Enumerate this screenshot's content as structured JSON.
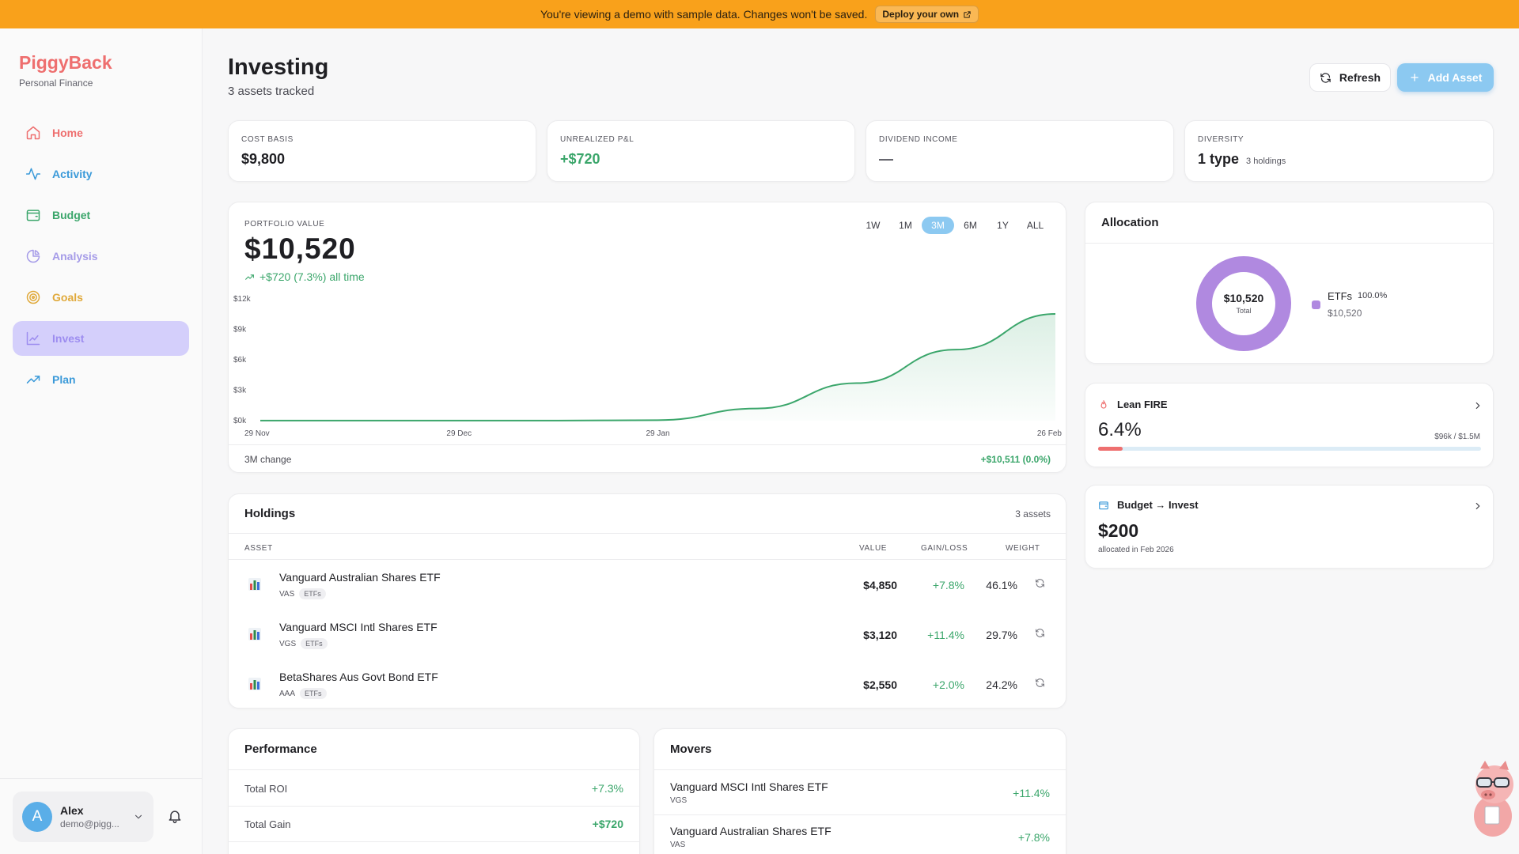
{
  "banner": {
    "message": "You're viewing a demo with sample data. Changes won't be saved.",
    "deploy_label": "Deploy your own"
  },
  "brand": {
    "name": "PiggyBack",
    "subtitle": "Personal Finance"
  },
  "nav": [
    {
      "label": "Home",
      "icon": "home-icon",
      "color": "#ee6f6f"
    },
    {
      "label": "Activity",
      "icon": "activity-icon",
      "color": "#3b9ad9"
    },
    {
      "label": "Budget",
      "icon": "wallet-icon",
      "color": "#3ba66b"
    },
    {
      "label": "Analysis",
      "icon": "pie-chart-icon",
      "color": "#a59be8"
    },
    {
      "label": "Goals",
      "icon": "target-icon",
      "color": "#e0a93a"
    },
    {
      "label": "Invest",
      "icon": "line-chart-icon",
      "color": "#9d8df0",
      "active": true
    },
    {
      "label": "Plan",
      "icon": "trending-up-icon",
      "color": "#3b9ad9"
    }
  ],
  "user": {
    "initial": "A",
    "name": "Alex",
    "email": "demo@pigg..."
  },
  "header": {
    "title": "Investing",
    "subtitle": "3 assets tracked",
    "refresh_label": "Refresh",
    "add_label": "Add Asset"
  },
  "stats": [
    {
      "label": "COST BASIS",
      "value": "$9,800"
    },
    {
      "label": "UNREALIZED P&L",
      "value": "+$720"
    },
    {
      "label": "DIVIDEND INCOME",
      "value": "—"
    },
    {
      "label": "DIVERSITY",
      "value": "1 type",
      "extra": "3 holdings"
    }
  ],
  "portfolio": {
    "label": "PORTFOLIO VALUE",
    "value": "$10,520",
    "change": "+$720 (7.3%) all time",
    "ranges": [
      "1W",
      "1M",
      "3M",
      "6M",
      "1Y",
      "ALL"
    ],
    "active_range": "3M",
    "footer_label": "3M change",
    "footer_value": "+$10,511 (0.0%)"
  },
  "chart_data": {
    "type": "area",
    "title": "",
    "xlabel": "",
    "ylabel": "",
    "y_ticks": [
      "$12k",
      "$9k",
      "$6k",
      "$3k",
      "$0k"
    ],
    "ylim": [
      0,
      12000
    ],
    "x_ticks": [
      "29 Nov",
      "29 Dec",
      "29 Jan",
      "26 Feb"
    ],
    "x": [
      "29 Nov",
      "13 Dec",
      "29 Dec",
      "13 Jan",
      "29 Jan",
      "5 Feb",
      "12 Feb",
      "19 Feb",
      "26 Feb"
    ],
    "values": [
      9,
      9,
      9,
      9,
      50,
      1200,
      3700,
      7000,
      10520
    ],
    "grid": false,
    "color": "#3ba66b"
  },
  "allocation": {
    "title": "Allocation",
    "total": "$10,520",
    "total_label": "Total",
    "legend": [
      {
        "name": "ETFs",
        "percent": "100.0%",
        "value": "$10,520",
        "color": "#b089e0"
      }
    ]
  },
  "fire": {
    "title": "Lean FIRE",
    "percent": "6.4%",
    "progress": 0.064,
    "detail": "$96k / $1.5M"
  },
  "budget_invest": {
    "title": "Budget → Invest",
    "amount": "$200",
    "note": "allocated in Feb 2026"
  },
  "holdings": {
    "title": "Holdings",
    "count": "3 assets",
    "columns": [
      "ASSET",
      "VALUE",
      "GAIN/LOSS",
      "WEIGHT"
    ],
    "rows": [
      {
        "name": "Vanguard Australian Shares ETF",
        "ticker": "VAS",
        "tag": "ETFs",
        "value": "$4,850",
        "gain": "+7.8%",
        "weight": "46.1%"
      },
      {
        "name": "Vanguard MSCI Intl Shares ETF",
        "ticker": "VGS",
        "tag": "ETFs",
        "value": "$3,120",
        "gain": "+11.4%",
        "weight": "29.7%"
      },
      {
        "name": "BetaShares Aus Govt Bond ETF",
        "ticker": "AAA",
        "tag": "ETFs",
        "value": "$2,550",
        "gain": "+2.0%",
        "weight": "24.2%"
      }
    ]
  },
  "performance": {
    "title": "Performance",
    "rows": [
      {
        "label": "Total ROI",
        "value": "+7.3%"
      },
      {
        "label": "Total Gain",
        "value": "+$720"
      }
    ]
  },
  "movers": {
    "title": "Movers",
    "rows": [
      {
        "name": "Vanguard MSCI Intl Shares ETF",
        "ticker": "VGS",
        "gain": "+11.4%"
      },
      {
        "name": "Vanguard Australian Shares ETF",
        "ticker": "VAS",
        "gain": "+7.8%"
      }
    ]
  }
}
